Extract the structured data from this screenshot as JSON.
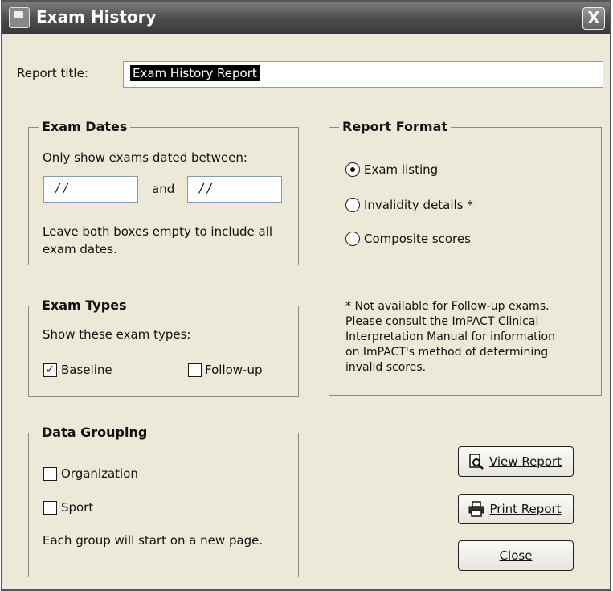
{
  "window": {
    "title": "Exam History",
    "close_glyph": "X"
  },
  "report_title": {
    "label": "Report title:",
    "value": "Exam History Report"
  },
  "exam_dates": {
    "legend": "Exam Dates",
    "instruction": "Only show exams dated between:",
    "from_value": "/ /",
    "and_label": "and",
    "to_value": "/ /",
    "note_line1": "Leave both boxes empty to include all",
    "note_line2": "exam dates."
  },
  "exam_types": {
    "legend": "Exam Types",
    "instruction": "Show these exam types:",
    "baseline": {
      "label": "Baseline",
      "checked": true,
      "mark": "✓"
    },
    "followup": {
      "label": "Follow-up",
      "checked": false
    }
  },
  "data_grouping": {
    "legend": "Data Grouping",
    "organization": {
      "label": "Organization",
      "checked": false
    },
    "sport": {
      "label": "Sport",
      "checked": false
    },
    "note": "Each group will start on a new page."
  },
  "report_format": {
    "legend": "Report Format",
    "options": [
      {
        "label": "Exam listing",
        "selected": true
      },
      {
        "label": "Invalidity details *",
        "selected": false
      },
      {
        "label": "Composite scores",
        "selected": false
      }
    ],
    "footnote_lines": [
      "* Not available for Follow-up exams.",
      "Please consult the ImPACT Clinical",
      "Interpretation Manual for information",
      "on ImPACT's method of determining",
      "invalid scores."
    ]
  },
  "buttons": {
    "view": {
      "label": "View Report",
      "icon": "magnifier-document-icon"
    },
    "print": {
      "label": "Print Report",
      "icon": "printer-icon"
    },
    "close": {
      "label": "Close"
    }
  }
}
